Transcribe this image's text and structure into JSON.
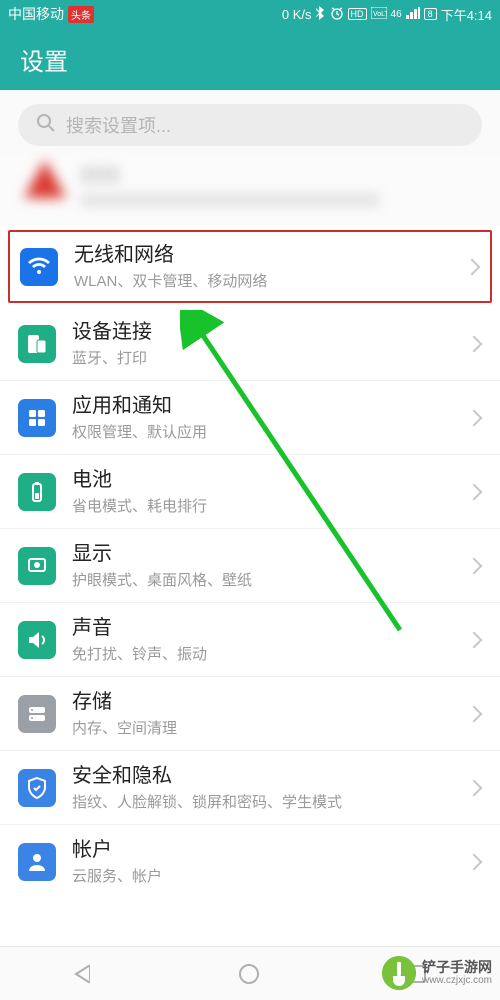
{
  "status_bar": {
    "carrier": "中国移动",
    "carrier_badge": "头条",
    "speed": "0 K/s",
    "hd": "HD",
    "net": "46",
    "battery": "8",
    "time": "下午4:14"
  },
  "header": {
    "title": "设置"
  },
  "search": {
    "placeholder": "搜索设置项..."
  },
  "items": [
    {
      "title": "无线和网络",
      "sub": "WLAN、双卡管理、移动网络",
      "icon": "wifi",
      "color": "icon-blue",
      "highlight": true
    },
    {
      "title": "设备连接",
      "sub": "蓝牙、打印",
      "icon": "device",
      "color": "icon-teal"
    },
    {
      "title": "应用和通知",
      "sub": "权限管理、默认应用",
      "icon": "apps",
      "color": "icon-blue2"
    },
    {
      "title": "电池",
      "sub": "省电模式、耗电排行",
      "icon": "battery",
      "color": "icon-teal2"
    },
    {
      "title": "显示",
      "sub": "护眼模式、桌面风格、壁纸",
      "icon": "display",
      "color": "icon-teal2"
    },
    {
      "title": "声音",
      "sub": "免打扰、铃声、振动",
      "icon": "sound",
      "color": "icon-teal2"
    },
    {
      "title": "存储",
      "sub": "内存、空间清理",
      "icon": "storage",
      "color": "icon-grey"
    },
    {
      "title": "安全和隐私",
      "sub": "指纹、人脸解锁、锁屏和密码、学生模式",
      "icon": "security",
      "color": "icon-blue3"
    },
    {
      "title": "帐户",
      "sub": "云服务、帐户",
      "icon": "account",
      "color": "icon-blue3"
    }
  ],
  "watermark": {
    "cn": "铲子手游网",
    "url": "www.czjxjc.com"
  }
}
